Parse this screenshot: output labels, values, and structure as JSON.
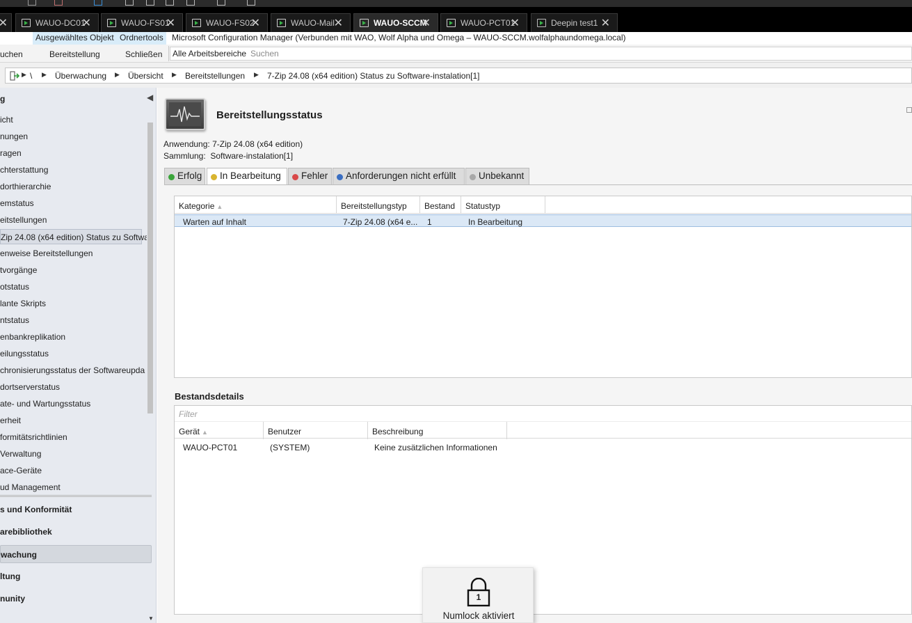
{
  "vm_tabs": [
    {
      "label": "",
      "active": false
    },
    {
      "label": "WAUO-DC01",
      "active": false
    },
    {
      "label": "WAUO-FS01",
      "active": false
    },
    {
      "label": "WAUO-FS02",
      "active": false
    },
    {
      "label": "WAUO-Mail",
      "active": false
    },
    {
      "label": "WAUO-SCCM",
      "active": true
    },
    {
      "label": "WAUO-PCT01",
      "active": false
    },
    {
      "label": "Deepin test1",
      "active": false
    }
  ],
  "context_tabs": {
    "selected_object": "Ausgewähltes Objekt",
    "folder_tools": "Ordnertools",
    "window_title": "Microsoft Configuration Manager (Verbunden mit WAO, Wolf Alpha und Omega – WAUO-SCCM.wolfalphaundomega.local)"
  },
  "ribbon": {
    "search": "uchen",
    "deployment": "Bereitstellung",
    "close": "Schließen",
    "all_workspaces": "Alle Arbeitsbereiche",
    "search_placeholder": "Suchen"
  },
  "breadcrumb": {
    "root": "\\",
    "items": [
      "Überwachung",
      "Übersicht",
      "Bereitstellungen",
      "7-Zip 24.08 (x64 edition) Status zu Software-instalation[1]"
    ]
  },
  "nav": {
    "header": "g",
    "items": [
      "icht",
      "nungen",
      "ragen",
      "chterstattung",
      "dorthierarchie",
      "emstatus",
      "eitstellungen",
      "Zip 24.08 (x64 edition) Status zu Softwa",
      "enweise Bereitstellungen",
      "tvorgänge",
      "otstatus",
      "lante Skripts",
      "ntstatus",
      "enbankreplikation",
      "eilungsstatus",
      "chronisierungsstatus der Softwareupda",
      "dortserverstatus",
      "ate- und Wartungsstatus",
      "erheit",
      "formitätsrichtlinien",
      "Verwaltung",
      "ace-Geräte",
      "ud Management"
    ],
    "selected_index": 7,
    "workspaces": [
      "s und Konformität",
      "arebibliothek",
      "wachung",
      "ltung",
      "nunity"
    ],
    "selected_workspace": 2
  },
  "header": {
    "title": "Bereitstellungsstatus",
    "application_label": "Anwendung:",
    "application_value": "7-Zip 24.08 (x64 edition)",
    "collection_label": "Sammlung:",
    "collection_value": "Software-instalation[1]"
  },
  "status_tabs": [
    {
      "label": "Erfolg",
      "color": "#3aa53a"
    },
    {
      "label": "In Bearbeitung",
      "color": "#d9b530"
    },
    {
      "label": "Fehler",
      "color": "#d94848"
    },
    {
      "label": "Anforderungen nicht erfüllt",
      "color": "#3a6ec2"
    },
    {
      "label": "Unbekannt",
      "color": "#a8a8a8"
    }
  ],
  "active_status_tab": 1,
  "summary_grid": {
    "columns": [
      "Kategorie",
      "Bereitstellungstyp",
      "Bestand",
      "Statustyp"
    ],
    "rows": [
      {
        "kategorie": "Warten auf Inhalt",
        "typ": "7-Zip 24.08 (x64 e...",
        "bestand": "1",
        "status": "In Bearbeitung"
      }
    ]
  },
  "details": {
    "title": "Bestandsdetails",
    "filter_placeholder": "Filter",
    "columns": [
      "Gerät",
      "Benutzer",
      "Beschreibung"
    ],
    "rows": [
      {
        "geraet": "WAUO-PCT01",
        "benutzer": "(SYSTEM)",
        "beschreibung": "Keine zusätzlichen Informationen"
      }
    ]
  },
  "toast": {
    "text": "Numlock aktiviert",
    "number": "1"
  }
}
